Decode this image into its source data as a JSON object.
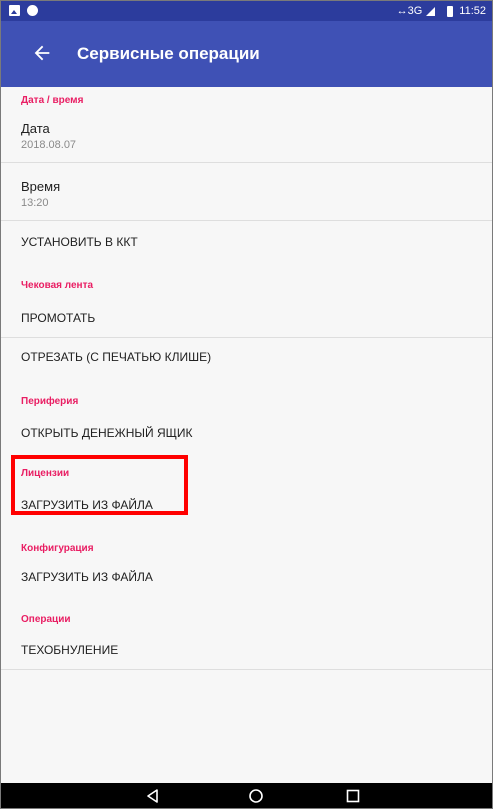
{
  "status_bar": {
    "network": "↔3G",
    "time": "11:52",
    "left_icons": [
      "gallery-notification-icon",
      "chat-bubble-notification-icon"
    ],
    "right_icons": [
      "signal-icon",
      "battery-icon"
    ]
  },
  "app_bar": {
    "title": "Сервисные операции",
    "back_icon": "arrow-back-icon",
    "color": "#3f51b5",
    "status_color": "#2c3c9d"
  },
  "sections": {
    "datetime": {
      "category": "Дата / время",
      "date": {
        "title": "Дата",
        "value": "2018.08.07"
      },
      "time": {
        "title": "Время",
        "value": "13:20"
      },
      "set_button": "УСТАНОВИТЬ В ККТ"
    },
    "receipt_tape": {
      "category": "Чековая лента",
      "scroll_button": "ПРОМОТАТЬ",
      "cut_button": "ОТРЕЗАТЬ (С ПЕЧАТЬЮ КЛИШЕ)"
    },
    "peripherals": {
      "category": "Периферия",
      "open_drawer_button": "ОТКРЫТЬ ДЕНЕЖНЫЙ ЯЩИК"
    },
    "licenses": {
      "category": "Лицензии",
      "load_button": "ЗАГРУЗИТЬ ИЗ ФАЙЛА"
    },
    "configuration": {
      "category": "Конфигурация",
      "load_button": "ЗАГРУЗИТЬ ИЗ ФАЙЛА"
    },
    "operations": {
      "category": "Операции",
      "tech_reset_button": "ТЕХОБНУЛЕНИЕ"
    }
  },
  "colors": {
    "category_accent": "#e91e63",
    "highlight": "#ff0000",
    "background": "#f7f7f7"
  },
  "nav_bar": {
    "icons": [
      "nav-back-icon",
      "nav-home-icon",
      "nav-recents-icon"
    ]
  }
}
